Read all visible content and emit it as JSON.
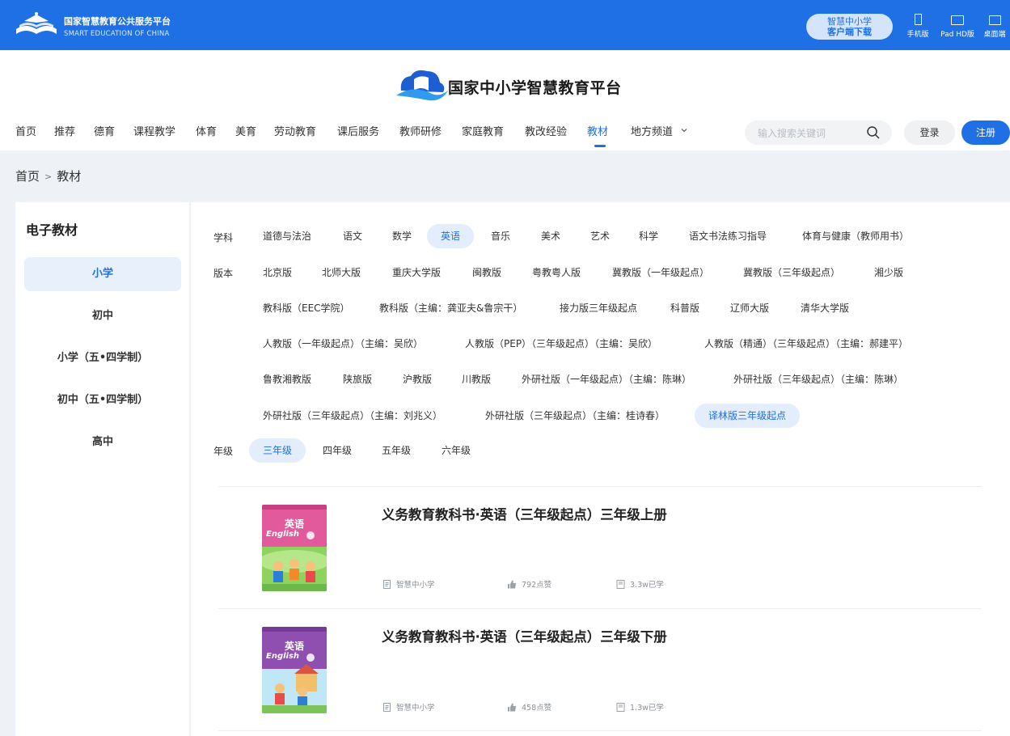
{
  "topbar": {
    "brand_cn": "国家智慧教育公共服务平台",
    "brand_en": "SMART EDUCATION OF CHINA",
    "download_line1": "智慧中小学",
    "download_line2": "客户端下载",
    "devices": [
      "手机版",
      "Pad HD版",
      "桌面端"
    ]
  },
  "header": {
    "brand_name": "国家中小学智慧教育平台"
  },
  "nav": {
    "items": [
      "首页",
      "推荐",
      "德育",
      "课程教学",
      "体育",
      "美育",
      "劳动教育",
      "课后服务",
      "教师研修",
      "家庭教育",
      "教改经验",
      "教材",
      "地方频道"
    ],
    "active": "教材",
    "dropdown_icon": "chevron-down-icon",
    "search_placeholder": "输入搜索关键词",
    "login": "登录",
    "register": "注册"
  },
  "breadcrumb": {
    "home": "首页",
    "sep": ">",
    "current": "教材"
  },
  "sidebar": {
    "title": "电子教材",
    "items": [
      "小学",
      "初中",
      "小学（五•四学制）",
      "初中（五•四学制）",
      "高中"
    ],
    "active": "小学"
  },
  "filters": {
    "subject_label": "学科",
    "subjects": [
      "道德与法治",
      "语文",
      "数学",
      "英语",
      "音乐",
      "美术",
      "艺术",
      "科学",
      "语文书法练习指导",
      "体育与健康（教师用书）"
    ],
    "subject_selected": "英语",
    "edition_label": "版本",
    "editions": [
      "北京版",
      "北师大版",
      "重庆大学版",
      "闽教版",
      "粤教粤人版",
      "冀教版（一年级起点）",
      "冀教版（三年级起点）",
      "湘少版",
      "教科版（EEC学院）",
      "教科版（主编：龚亚夫&鲁宗干）",
      "接力版三年级起点",
      "科普版",
      "辽师大版",
      "清华大学版",
      "人教版（一年级起点）（主编：吴欣）",
      "人教版（PEP）（三年级起点）（主编：吴欣）",
      "人教版（精通）（三年级起点）（主编：郝建平）",
      "鲁教湘教版",
      "陕旅版",
      "沪教版",
      "川教版",
      "外研社版（一年级起点）（主编：陈琳）",
      "外研社版（三年级起点）（主编：陈琳）",
      "外研社版（三年级起点）（主编：刘兆义）",
      "外研社版（三年级起点）（主编：桂诗春）",
      "译林版三年级起点"
    ],
    "edition_selected": "译林版三年级起点",
    "grade_label": "年级",
    "grades": [
      "三年级",
      "四年级",
      "五年级",
      "六年级"
    ],
    "grade_selected": "三年级"
  },
  "books": [
    {
      "title": "义务教育教科书·英语（三年级起点）三年级上册",
      "publisher": "智慧中小学",
      "likes": "792点赞",
      "learners": "3.3w已学",
      "cover_title": "英语",
      "cover_en": "English",
      "cover_color": "#e35a9c"
    },
    {
      "title": "义务教育教科书·英语（三年级起点）三年级下册",
      "publisher": "智慧中小学",
      "likes": "458点赞",
      "learners": "1.3w已学",
      "cover_title": "英语",
      "cover_en": "English",
      "cover_color": "#8e4fb0"
    }
  ],
  "colors": {
    "primary": "#1f6fe5",
    "page_bg": "#eef1f6",
    "chip_bg": "#e3edfc"
  }
}
